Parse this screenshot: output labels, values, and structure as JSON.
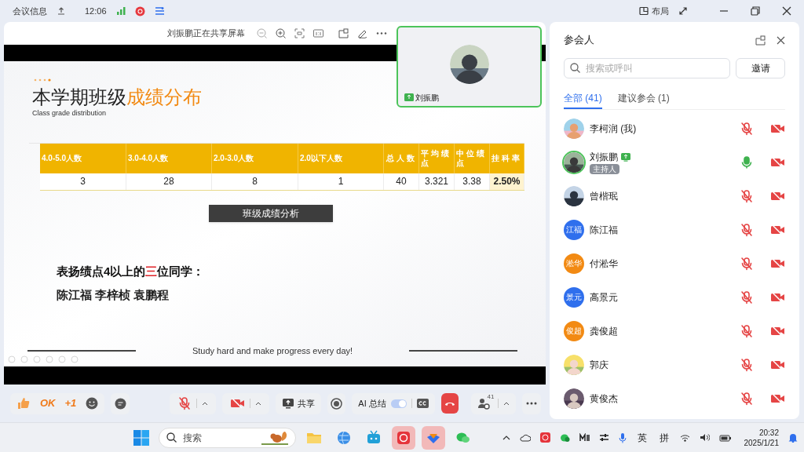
{
  "title_bar": {
    "meeting_info": "会议信息",
    "time": "12:06",
    "layout": "布局"
  },
  "share_toolbar": {
    "label": "刘振鹏正在共享屏幕"
  },
  "video_tile": {
    "name": "刘振鹏",
    "sharing": true
  },
  "slide": {
    "title": "本学期班级",
    "title_highlight": "成绩分布",
    "subtitle": "Class grade distribution",
    "table": {
      "columns": [
        "4.0-5.0人数",
        "3.0-4.0人数",
        "2.0-3.0人数",
        "2.0以下人数",
        "总人数",
        "平均绩点",
        "中位绩点",
        "挂科率"
      ],
      "rows": [
        {
          "cells": [
            "3",
            "28",
            "8",
            "1",
            "40",
            "3.321",
            "3.38",
            "2.50%"
          ],
          "highlight_last": true
        }
      ]
    },
    "section_button": "班级成绩分析",
    "praise": [
      {
        "text": "表扬绩点4以上的",
        "emphasis": false
      },
      {
        "text": "三",
        "emphasis": true
      },
      {
        "text": "位同学：",
        "emphasis": false
      }
    ],
    "names": "陈江福 李梓桢 袁鹏程",
    "footer": "Study hard and make progress every day!"
  },
  "controls": {
    "reactions": [
      "OK",
      "+1"
    ],
    "share": "共享",
    "ai_summary": {
      "label": "AI 总结",
      "on": true
    },
    "participants_count": "41"
  },
  "panel": {
    "title": "参会人",
    "search": {
      "placeholder": "搜索或呼叫"
    },
    "invite": "邀请",
    "tabs": [
      {
        "label": "全部 (41)",
        "selected": true
      },
      {
        "label": "建议参会 (1)",
        "selected": false
      }
    ],
    "participants": [
      {
        "name": "李柯润 (我)",
        "muted": true
      },
      {
        "name": "刘振鹏",
        "muted": false,
        "sharing": true,
        "badge": "主持人"
      },
      {
        "name": "曾楷珉",
        "muted": true
      },
      {
        "name": "陈江福",
        "avatar": {
          "kind": "initials",
          "text": "江福",
          "color": "#2f6fed"
        },
        "muted": true
      },
      {
        "name": "付淞华",
        "avatar": {
          "kind": "initials",
          "text": "淞华",
          "color": "#f28a13"
        },
        "muted": true
      },
      {
        "name": "高景元",
        "avatar": {
          "kind": "initials",
          "text": "景元",
          "color": "#2f6fed"
        },
        "muted": true
      },
      {
        "name": "龚俊超",
        "avatar": {
          "kind": "initials",
          "text": "俊超",
          "color": "#f28a13"
        },
        "muted": true
      },
      {
        "name": "郭庆",
        "muted": true
      },
      {
        "name": "黄俊杰",
        "muted": true
      }
    ]
  },
  "taskbar": {
    "search": {
      "placeholder": "搜索"
    },
    "ime": [
      "英",
      "拼"
    ],
    "time": "20:32",
    "date": "2025/1/21"
  }
}
